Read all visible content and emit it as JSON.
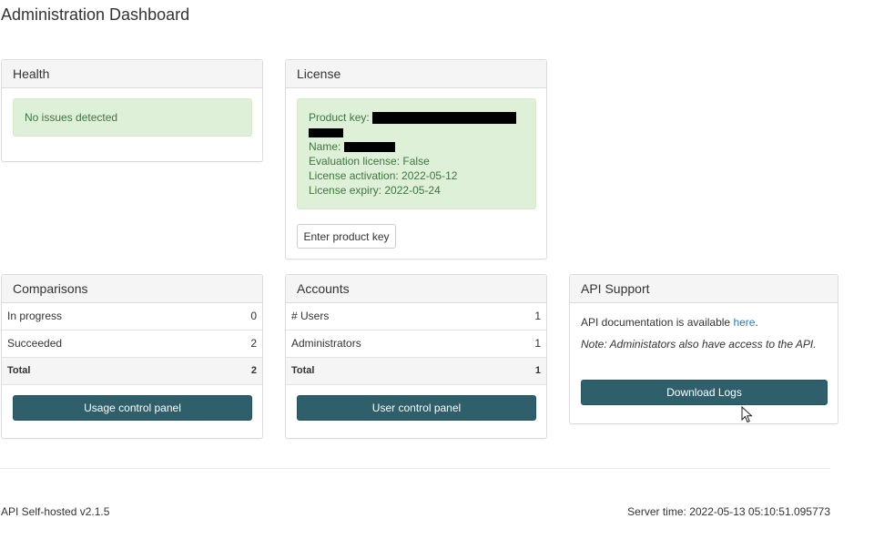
{
  "page": {
    "title": "Administration Dashboard"
  },
  "colors": {
    "primary_button": "#2e5f6b",
    "success_bg": "#dff0d8",
    "success_text": "#3c763d",
    "link": "#337ab7"
  },
  "health": {
    "title": "Health",
    "status": "No issues detected"
  },
  "license": {
    "title": "License",
    "product_key_label": "Product key:",
    "name_label": "Name:",
    "evaluation": "Evaluation license: False",
    "activation": "License activation: 2022-05-12",
    "expiry": "License expiry: 2022-05-24",
    "enter_key_button": "Enter product key"
  },
  "comparisons": {
    "title": "Comparisons",
    "rows": [
      {
        "label": "In progress",
        "value": "0"
      },
      {
        "label": "Succeeded",
        "value": "2"
      }
    ],
    "total": {
      "label": "Total",
      "value": "2"
    },
    "button": "Usage control panel"
  },
  "accounts": {
    "title": "Accounts",
    "rows": [
      {
        "label": "# Users",
        "value": "1"
      },
      {
        "label": "Administrators",
        "value": "1"
      }
    ],
    "total": {
      "label": "Total",
      "value": "1"
    },
    "button": "User control panel"
  },
  "api_support": {
    "title": "API Support",
    "doc_prefix": "API documentation is available ",
    "doc_link": "here",
    "doc_suffix": ".",
    "note": "Note: Administators also have access to the API.",
    "download_button": "Download Logs"
  },
  "footer": {
    "version": "API Self-hosted v2.1.5",
    "server_time": "Server time: 2022-05-13 05:10:51.095773"
  }
}
